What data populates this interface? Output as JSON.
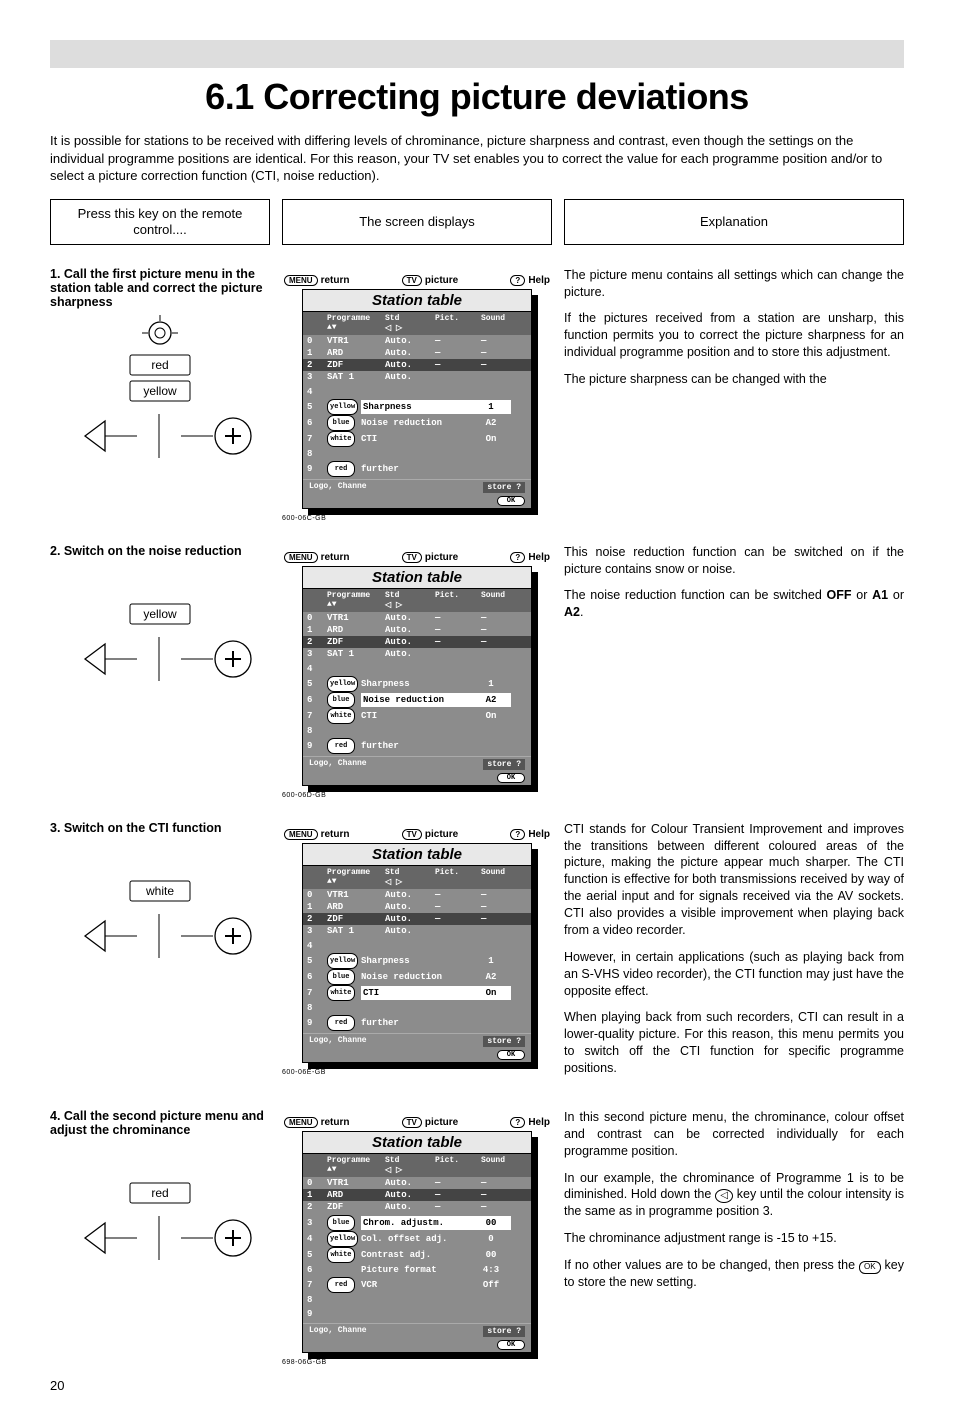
{
  "page_number": "20",
  "title": "6.1 Correcting picture deviations",
  "intro": "It is possible for stations to be received with differing levels of chrominance, picture sharpness and contrast, even though the settings on the individual programme positions are identical. For this reason, your TV set enables you to correct the value for each programme position and/or to select a picture correction function (CTI, noise reduction).",
  "headers": {
    "remote": "Press this key on the remote control....",
    "screen": "The screen displays",
    "explain": "Explanation"
  },
  "topbar": {
    "return": "return",
    "picture": "picture",
    "help": "Help",
    "menu_btn": "MENU",
    "tv_btn": "TV",
    "help_btn": "?"
  },
  "osd_common": {
    "title": "Station table",
    "head_prog": "Programme",
    "head_std": "Std",
    "head_pict": "Pict.",
    "head_sound": "Sound",
    "rows": [
      {
        "n": "0",
        "name": "VTR1",
        "std": "Auto.",
        "p": "—",
        "s": "—"
      },
      {
        "n": "1",
        "name": "ARD",
        "std": "Auto.",
        "p": "—",
        "s": "—"
      },
      {
        "n": "2",
        "name": "ZDF",
        "std": "Auto.",
        "p": "—",
        "s": "—"
      },
      {
        "n": "3",
        "name": "SAT 1",
        "std": "Auto.",
        "p": "",
        "s": ""
      }
    ],
    "nums_side": [
      "4",
      "5",
      "6",
      "7",
      "8",
      "9"
    ],
    "opt_sharp": "Sharpness",
    "opt_noise": "Noise reduction",
    "opt_cti": "CTI",
    "opt_further": "further",
    "chip_yellow": "yellow",
    "chip_blue": "blue",
    "chip_white": "white",
    "chip_red": "red",
    "val_sharp": "1",
    "val_noise": "A2",
    "val_cti": "On",
    "footer_left": "Logo, Channe",
    "footer_store": "store ?",
    "footer_ok": "OK"
  },
  "steps": [
    {
      "title": "1. Call the first picture menu in the station table and correct the picture sharpness",
      "labels": [
        "red",
        "yellow"
      ],
      "code": "600-06C-GB",
      "highlight": "sharp",
      "explain": [
        "The picture menu contains all settings which can change the picture.",
        "If the pictures received from a station are unsharp, this function permits you to correct the picture sharpness for an individual programme position and to store this adjustment.",
        "The picture sharpness can be changed with the"
      ]
    },
    {
      "title": "2. Switch on the noise reduction",
      "labels": [
        "yellow"
      ],
      "code": "600-06D-GB",
      "highlight": "noise",
      "explain": [
        "This noise reduction function can be switched on if the picture contains snow or noise.",
        "The noise reduction function can be switched <b>OFF</b> or <b>A1</b> or <b>A2</b>."
      ]
    },
    {
      "title": "3. Switch on the CTI function",
      "labels": [
        "white"
      ],
      "code": "600-06E-GB",
      "highlight": "cti",
      "explain": [
        "CTI stands for Colour Transient Improvement and improves the transitions between different coloured areas of the picture, making the picture appear much sharper. The CTI function is effective for both transmissions received by way of the aerial input and for signals received via the AV sockets. CTI also provides a visible improvement when playing back from a video recorder.",
        "However, in certain applications (such as playing back from an S-VHS video recorder), the CTI function may just have the opposite effect.",
        "When playing back from such recorders, CTI can result in a lower-quality picture. For this reason, this menu permits you to switch off the CTI function for specific programme positions."
      ]
    },
    {
      "title": "4. Call the second picture menu and adjust the chrominance",
      "labels": [
        "red"
      ],
      "code": "698-06G-GB",
      "menu2": true,
      "explain": [
        "In this second picture menu, the chrominance, colour offset and contrast can be corrected individually for each programme position.",
        "In our example, the chrominance of Programme 1 is to be diminished. Hold down the <span class='keyglyph'>◁</span> key until the colour intensity is the same as in programme position 3.",
        "The chrominance adjustment range is -15 to +15.",
        "If no other values are to be changed, then press the <span class='tinybox'>OK</span> key to store the new setting."
      ]
    }
  ],
  "menu2_opts": [
    {
      "chip": "blue",
      "label": "Chrom. adjustm.",
      "val": "00",
      "hl": true
    },
    {
      "chip": "yellow",
      "label": "Col. offset adj.",
      "val": "0"
    },
    {
      "chip": "white",
      "label": "Contrast adj.",
      "val": "00"
    },
    {
      "chip": "",
      "label": "Picture format",
      "val": "4:3"
    },
    {
      "chip": "red",
      "label": "VCR",
      "val": "Off"
    }
  ]
}
